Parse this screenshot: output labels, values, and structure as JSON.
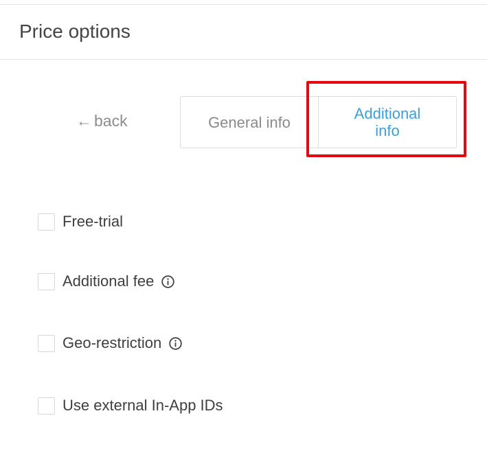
{
  "header": {
    "title": "Price options"
  },
  "nav": {
    "back_arrow": "←",
    "back_label": "back"
  },
  "tabs": [
    {
      "label": "General info",
      "active": false
    },
    {
      "label": "Additional info",
      "active": true,
      "label_line1": "Additional",
      "label_line2": "info"
    }
  ],
  "colors": {
    "accent": "#39a0dc",
    "highlight": "#e8070f",
    "muted_text": "#8a8a8a"
  },
  "options": [
    {
      "label": "Free-trial",
      "checked": false,
      "has_info_icon": false
    },
    {
      "label": "Additional fee",
      "checked": false,
      "has_info_icon": true,
      "icon": "info-icon"
    },
    {
      "label": "Geo-restriction",
      "checked": false,
      "has_info_icon": true,
      "icon": "info-icon"
    },
    {
      "label": "Use external In-App IDs",
      "checked": false,
      "has_info_icon": false
    }
  ]
}
